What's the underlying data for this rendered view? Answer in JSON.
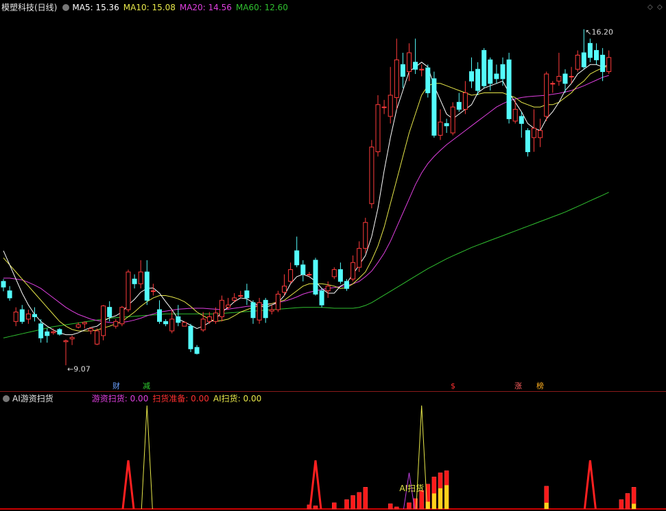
{
  "header": {
    "title": "模塑科技(日线)",
    "ma5": "MA5: 15.36",
    "ma10": "MA10: 15.08",
    "ma20": "MA20: 14.56",
    "ma60": "MA60: 12.60"
  },
  "indicator_header": {
    "title": "AI游资扫货",
    "ind1": "游资扫货: 0.00",
    "ind2": "扫货准备: 0.00",
    "ind3": "AI扫货: 0.00"
  },
  "markers": [
    {
      "text": "财",
      "color": "#6aa0ff"
    },
    {
      "text": "减",
      "color": "#30d030"
    },
    {
      "text": "$",
      "color": "#ff3030"
    },
    {
      "text": "涨",
      "color": "#ff6060"
    },
    {
      "text": "榜",
      "color": "#ffb020"
    }
  ],
  "annotations": {
    "high_label": "16.20",
    "low_label": "9.07",
    "ai_label": "AI扫货"
  },
  "colors": {
    "up": "#ff3b3b",
    "down": "#54fcfc",
    "ma5": "#ffffff",
    "ma10": "#e8e84a",
    "ma20": "#e040e0",
    "ma60": "#30c030"
  },
  "chart_data": [
    {
      "type": "candlestick",
      "title": "模塑科技(日线)",
      "y_range": [
        8.9,
        16.5
      ],
      "high": 16.2,
      "low": 9.07,
      "candles": [
        [
          10.85,
          10.73,
          10.9,
          10.64
        ],
        [
          10.65,
          10.5,
          10.75,
          10.44
        ],
        [
          10.0,
          10.2,
          10.3,
          9.9
        ],
        [
          10.25,
          10.0,
          10.35,
          9.95
        ],
        [
          10.05,
          10.16,
          10.25,
          9.95
        ],
        [
          10.15,
          10.1,
          10.3,
          10.0
        ],
        [
          9.95,
          9.65,
          10.05,
          9.55
        ],
        [
          9.78,
          9.7,
          9.85,
          9.55
        ],
        [
          9.76,
          9.78,
          9.85,
          9.72
        ],
        [
          9.83,
          9.73,
          9.86,
          9.7
        ],
        [
          9.57,
          9.59,
          9.62,
          9.07
        ],
        [
          9.63,
          9.66,
          9.7,
          9.5
        ],
        [
          9.88,
          9.93,
          9.98,
          9.85
        ],
        [
          9.95,
          9.98,
          10.0,
          9.85
        ],
        [
          9.8,
          9.85,
          9.88,
          9.73
        ],
        [
          9.52,
          9.8,
          9.85,
          9.5
        ],
        [
          9.7,
          10.33,
          10.35,
          9.6
        ],
        [
          10.3,
          10.1,
          10.43,
          10.0
        ],
        [
          9.9,
          10.0,
          10.05,
          9.85
        ],
        [
          9.95,
          10.3,
          10.33,
          9.9
        ],
        [
          10.25,
          11.05,
          11.1,
          10.2
        ],
        [
          10.9,
          10.8,
          11.0,
          10.7
        ],
        [
          10.8,
          11.05,
          11.3,
          10.7
        ],
        [
          11.05,
          10.45,
          11.3,
          10.35
        ],
        [
          10.65,
          10.65,
          10.8,
          10.55
        ],
        [
          10.25,
          10.0,
          10.45,
          9.95
        ],
        [
          10.0,
          9.95,
          10.05,
          9.9
        ],
        [
          9.8,
          10.05,
          10.25,
          9.75
        ],
        [
          10.1,
          9.98,
          10.35,
          9.9
        ],
        [
          9.9,
          9.98,
          10.0,
          9.9
        ],
        [
          9.9,
          9.42,
          9.95,
          9.35
        ],
        [
          9.45,
          9.32,
          9.5,
          9.3
        ],
        [
          9.82,
          10.05,
          10.2,
          9.78
        ],
        [
          10.0,
          10.1,
          10.2,
          9.95
        ],
        [
          10.0,
          10.18,
          10.3,
          9.95
        ],
        [
          10.1,
          10.45,
          10.55,
          10.0
        ],
        [
          10.3,
          10.35,
          10.5,
          10.25
        ],
        [
          10.45,
          10.5,
          10.6,
          10.4
        ],
        [
          10.55,
          10.55,
          10.65,
          10.5
        ],
        [
          10.65,
          10.5,
          10.8,
          10.35
        ],
        [
          10.4,
          10.08,
          10.45,
          9.95
        ],
        [
          10.03,
          10.4,
          10.5,
          9.95
        ],
        [
          10.45,
          10.08,
          10.5,
          9.97
        ],
        [
          10.22,
          10.25,
          10.35,
          10.15
        ],
        [
          10.25,
          10.58,
          10.65,
          10.2
        ],
        [
          10.62,
          10.75,
          11.0,
          10.55
        ],
        [
          10.85,
          11.1,
          11.25,
          10.8
        ],
        [
          11.5,
          11.2,
          11.8,
          11.15
        ],
        [
          11.2,
          11.0,
          11.3,
          10.85
        ],
        [
          11.0,
          11.0,
          11.05,
          10.95
        ],
        [
          11.3,
          10.58,
          11.35,
          10.55
        ],
        [
          10.65,
          10.35,
          10.7,
          10.3
        ],
        [
          10.65,
          10.75,
          10.85,
          10.5
        ],
        [
          10.95,
          11.1,
          11.15,
          10.9
        ],
        [
          11.1,
          10.85,
          11.25,
          10.8
        ],
        [
          10.85,
          10.7,
          10.9,
          10.65
        ],
        [
          10.9,
          11.25,
          11.4,
          10.85
        ],
        [
          11.15,
          11.55,
          11.7,
          11.05
        ],
        [
          11.55,
          12.1,
          12.2,
          11.45
        ],
        [
          12.5,
          13.7,
          13.85,
          12.4
        ],
        [
          13.6,
          14.6,
          14.8,
          13.5
        ],
        [
          14.55,
          14.55,
          14.7,
          14.4
        ],
        [
          14.35,
          14.8,
          15.4,
          14.2
        ],
        [
          14.75,
          15.55,
          16.0,
          14.5
        ],
        [
          15.45,
          15.2,
          15.7,
          14.95
        ],
        [
          15.3,
          15.7,
          15.9,
          15.1
        ],
        [
          15.5,
          15.35,
          16.0,
          15.25
        ],
        [
          15.35,
          15.35,
          15.45,
          15.2
        ],
        [
          15.38,
          14.85,
          15.45,
          14.75
        ],
        [
          15.15,
          13.95,
          15.3,
          13.9
        ],
        [
          13.95,
          14.23,
          14.5,
          13.85
        ],
        [
          14.2,
          14.15,
          14.3,
          14.0
        ],
        [
          14.0,
          14.55,
          14.65,
          13.95
        ],
        [
          14.65,
          14.5,
          14.85,
          14.45
        ],
        [
          14.5,
          14.85,
          15.1,
          14.4
        ],
        [
          15.3,
          15.1,
          15.6,
          14.95
        ],
        [
          15.35,
          14.9,
          15.5,
          14.8
        ],
        [
          15.75,
          15.0,
          15.8,
          14.95
        ],
        [
          15.55,
          15.05,
          15.6,
          14.9
        ],
        [
          15.25,
          15.15,
          15.45,
          15.05
        ],
        [
          15.45,
          15.15,
          15.6,
          15.0
        ],
        [
          15.55,
          14.3,
          15.7,
          14.2
        ],
        [
          14.25,
          14.5,
          14.7,
          14.2
        ],
        [
          14.35,
          14.2,
          14.45,
          13.9
        ],
        [
          14.05,
          13.6,
          14.1,
          13.5
        ],
        [
          13.9,
          14.1,
          14.5,
          13.6
        ],
        [
          13.9,
          14.05,
          14.3,
          13.7
        ],
        [
          14.35,
          15.25,
          15.3,
          14.25
        ],
        [
          15.05,
          15.05,
          15.1,
          14.85
        ],
        [
          15.1,
          15.2,
          15.7,
          15.0
        ],
        [
          15.25,
          15.05,
          15.35,
          14.85
        ],
        [
          15.2,
          15.2,
          15.4,
          15.05
        ],
        [
          15.35,
          15.65,
          15.75,
          15.3
        ],
        [
          15.7,
          15.4,
          16.2,
          15.35
        ],
        [
          15.9,
          15.6,
          16.0,
          15.5
        ],
        [
          15.75,
          15.55,
          15.9,
          15.45
        ],
        [
          15.65,
          15.3,
          15.8,
          15.1
        ],
        [
          15.3,
          15.6,
          15.75,
          15.25
        ]
      ],
      "ma5": [
        11.5,
        11.2,
        10.9,
        10.6,
        10.35,
        10.15,
        10.0,
        9.9,
        9.82,
        9.76,
        9.72,
        9.72,
        9.76,
        9.82,
        9.87,
        9.9,
        10.0,
        10.08,
        10.12,
        10.2,
        10.35,
        10.47,
        10.62,
        10.7,
        10.71,
        10.6,
        10.42,
        10.25,
        10.05,
        9.99,
        9.92,
        9.85,
        9.9,
        9.98,
        10.05,
        10.2,
        10.3,
        10.42,
        10.5,
        10.48,
        10.4,
        10.33,
        10.3,
        10.35,
        10.4,
        10.55,
        10.8,
        10.95,
        11.0,
        10.95,
        10.85,
        10.7,
        10.6,
        10.6,
        10.75,
        10.82,
        11.0,
        11.2,
        11.4,
        11.8,
        12.4,
        13.2,
        13.9,
        14.5,
        14.9,
        15.3,
        15.4,
        15.5,
        15.4,
        15.0,
        14.7,
        14.4,
        14.3,
        14.4,
        14.5,
        14.6,
        14.85,
        14.95,
        15.0,
        15.05,
        15.1,
        14.85,
        14.65,
        14.45,
        14.2,
        14.1,
        14.05,
        14.3,
        14.45,
        14.65,
        14.9,
        15.05,
        15.25,
        15.35,
        15.45,
        15.45,
        15.4,
        15.45
      ],
      "ma10": [
        11.35,
        11.2,
        11.05,
        10.9,
        10.75,
        10.6,
        10.45,
        10.3,
        10.15,
        10.0,
        9.9,
        9.83,
        9.8,
        9.8,
        9.8,
        9.82,
        9.86,
        9.9,
        9.95,
        10.0,
        10.1,
        10.2,
        10.32,
        10.42,
        10.5,
        10.55,
        10.55,
        10.52,
        10.48,
        10.42,
        10.32,
        10.2,
        10.12,
        10.05,
        10.0,
        10.02,
        10.05,
        10.12,
        10.2,
        10.25,
        10.3,
        10.33,
        10.35,
        10.38,
        10.42,
        10.45,
        10.55,
        10.65,
        10.75,
        10.8,
        10.8,
        10.8,
        10.78,
        10.75,
        10.7,
        10.72,
        10.8,
        10.92,
        11.05,
        11.3,
        11.6,
        12.0,
        12.5,
        13.0,
        13.5,
        14.0,
        14.4,
        14.8,
        15.0,
        15.05,
        15.05,
        15.0,
        14.95,
        14.9,
        14.85,
        14.8,
        14.82,
        14.85,
        14.85,
        14.85,
        14.85,
        14.8,
        14.75,
        14.65,
        14.6,
        14.55,
        14.55,
        14.6,
        14.6,
        14.65,
        14.75,
        14.85,
        15.0,
        15.1,
        15.25,
        15.32,
        15.38,
        15.42
      ],
      "ma20": [
        10.92,
        10.92,
        10.9,
        10.88,
        10.83,
        10.77,
        10.7,
        10.6,
        10.5,
        10.4,
        10.3,
        10.22,
        10.15,
        10.1,
        10.05,
        10.02,
        10.0,
        9.98,
        9.97,
        9.98,
        10.0,
        10.03,
        10.07,
        10.12,
        10.16,
        10.2,
        10.22,
        10.24,
        10.26,
        10.27,
        10.28,
        10.28,
        10.28,
        10.27,
        10.26,
        10.25,
        10.26,
        10.28,
        10.3,
        10.32,
        10.33,
        10.35,
        10.37,
        10.38,
        10.4,
        10.43,
        10.47,
        10.52,
        10.58,
        10.62,
        10.65,
        10.68,
        10.7,
        10.72,
        10.74,
        10.76,
        10.8,
        10.85,
        10.95,
        11.07,
        11.25,
        11.45,
        11.7,
        12.0,
        12.3,
        12.6,
        12.9,
        13.15,
        13.35,
        13.5,
        13.63,
        13.75,
        13.85,
        13.95,
        14.05,
        14.15,
        14.25,
        14.35,
        14.45,
        14.55,
        14.62,
        14.68,
        14.72,
        14.75,
        14.77,
        14.78,
        14.79,
        14.8,
        14.82,
        14.84,
        14.87,
        14.9,
        14.95,
        15.0,
        15.06,
        15.12,
        15.18,
        15.22
      ],
      "ma60": [
        9.65,
        9.68,
        9.71,
        9.74,
        9.77,
        9.8,
        9.83,
        9.86,
        9.89,
        9.91,
        9.93,
        9.95,
        9.97,
        9.99,
        10.01,
        10.03,
        10.05,
        10.07,
        10.08,
        10.09,
        10.1,
        10.11,
        10.12,
        10.13,
        10.14,
        10.15,
        10.16,
        10.16,
        10.16,
        10.16,
        10.16,
        10.16,
        10.16,
        10.16,
        10.16,
        10.17,
        10.18,
        10.19,
        10.2,
        10.21,
        10.22,
        10.23,
        10.24,
        10.25,
        10.26,
        10.27,
        10.28,
        10.29,
        10.3,
        10.3,
        10.3,
        10.3,
        10.29,
        10.28,
        10.28,
        10.28,
        10.28,
        10.3,
        10.34,
        10.4,
        10.48,
        10.56,
        10.64,
        10.72,
        10.8,
        10.88,
        10.96,
        11.04,
        11.12,
        11.19,
        11.26,
        11.33,
        11.39,
        11.45,
        11.51,
        11.57,
        11.62,
        11.67,
        11.72,
        11.77,
        11.82,
        11.87,
        11.92,
        11.97,
        12.02,
        12.07,
        12.12,
        12.17,
        12.22,
        12.27,
        12.32,
        12.38,
        12.44,
        12.5,
        12.56,
        12.62,
        12.68,
        12.74
      ]
    },
    {
      "type": "bar",
      "title": "AI游资扫货",
      "y_range": [
        0,
        100
      ],
      "series": [
        {
          "name": "游资扫货",
          "bars": [
            [
              49,
              4
            ],
            [
              50,
              3
            ],
            [
              53,
              6
            ],
            [
              55,
              9
            ],
            [
              56,
              13
            ],
            [
              57,
              16
            ],
            [
              58,
              21
            ],
            [
              62,
              5
            ],
            [
              63,
              2
            ],
            [
              65,
              6
            ],
            [
              66,
              10
            ],
            [
              67,
              18
            ],
            [
              68,
              24
            ],
            [
              69,
              31
            ],
            [
              70,
              35
            ],
            [
              71,
              37
            ],
            [
              87,
              22
            ],
            [
              99,
              9
            ],
            [
              100,
              15
            ],
            [
              101,
              21
            ]
          ]
        },
        {
          "name": "AI扫货",
          "bars": [
            [
              68,
              7
            ],
            [
              69,
              15
            ],
            [
              70,
              20
            ],
            [
              71,
              23
            ],
            [
              87,
              6
            ],
            [
              101,
              5
            ]
          ]
        },
        {
          "name": "扫货准备",
          "peaks": [
            [
              20,
              47
            ],
            [
              50,
              47
            ],
            [
              94,
              47
            ]
          ]
        },
        {
          "name": "AI线",
          "peaks": [
            [
              23,
              100
            ],
            [
              67,
              100
            ]
          ]
        },
        {
          "name": "游资线",
          "peaks": [
            [
              65,
              35
            ]
          ]
        }
      ]
    }
  ]
}
